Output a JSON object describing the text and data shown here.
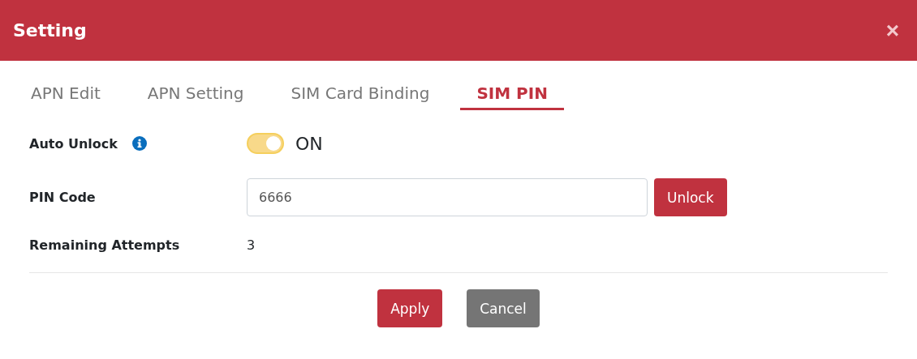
{
  "window": {
    "title": "Setting",
    "close": "×"
  },
  "tabs": [
    {
      "label": "APN Edit",
      "selected": false
    },
    {
      "label": "APN Setting",
      "selected": false
    },
    {
      "label": "SIM Card Binding",
      "selected": false
    },
    {
      "label": "SIM PIN",
      "selected": true
    }
  ],
  "fields": [
    {
      "kind": "toggle",
      "label": "Auto Unlock",
      "info": true,
      "on": true,
      "state_text": "ON"
    },
    {
      "kind": "pin",
      "label": "PIN Code",
      "value": "6666",
      "button": "Unlock"
    },
    {
      "kind": "text",
      "label": "Remaining Attempts",
      "value": "3"
    }
  ],
  "buttons": [
    {
      "label": "Apply",
      "kind": "primary"
    },
    {
      "label": "Cancel",
      "kind": "secondary"
    }
  ]
}
